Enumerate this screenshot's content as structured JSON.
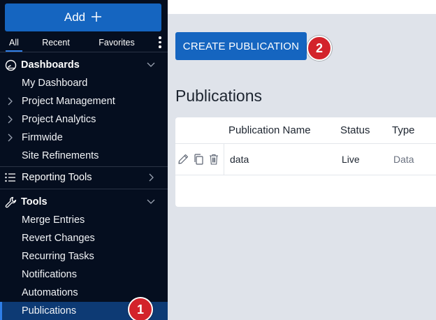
{
  "sidebar": {
    "add_label": "Add",
    "tabs": [
      {
        "label": "All"
      },
      {
        "label": "Recent"
      },
      {
        "label": "Favorites"
      }
    ],
    "dashboards": {
      "title": "Dashboards",
      "items": [
        {
          "label": "My Dashboard"
        },
        {
          "label": "Project Management"
        },
        {
          "label": "Project Analytics"
        },
        {
          "label": "Firmwide"
        },
        {
          "label": "Site Refinements"
        }
      ]
    },
    "reporting_tools": {
      "label": "Reporting Tools"
    },
    "tools": {
      "title": "Tools",
      "items": [
        {
          "label": "Merge Entries"
        },
        {
          "label": "Revert Changes"
        },
        {
          "label": "Recurring Tasks"
        },
        {
          "label": "Notifications"
        },
        {
          "label": "Automations"
        },
        {
          "label": "Publications"
        }
      ]
    },
    "badge": "1"
  },
  "main": {
    "create_button": "CREATE PUBLICATION",
    "badge": "2",
    "title": "Publications",
    "table": {
      "columns": [
        "Publication Name",
        "Status",
        "Type"
      ],
      "rows": [
        {
          "name": "data",
          "status": "Live",
          "type": "Data"
        }
      ]
    }
  },
  "colors": {
    "accent": "#1565c0",
    "sidebar_bg": "#050e1f",
    "badge": "#d3232b"
  }
}
